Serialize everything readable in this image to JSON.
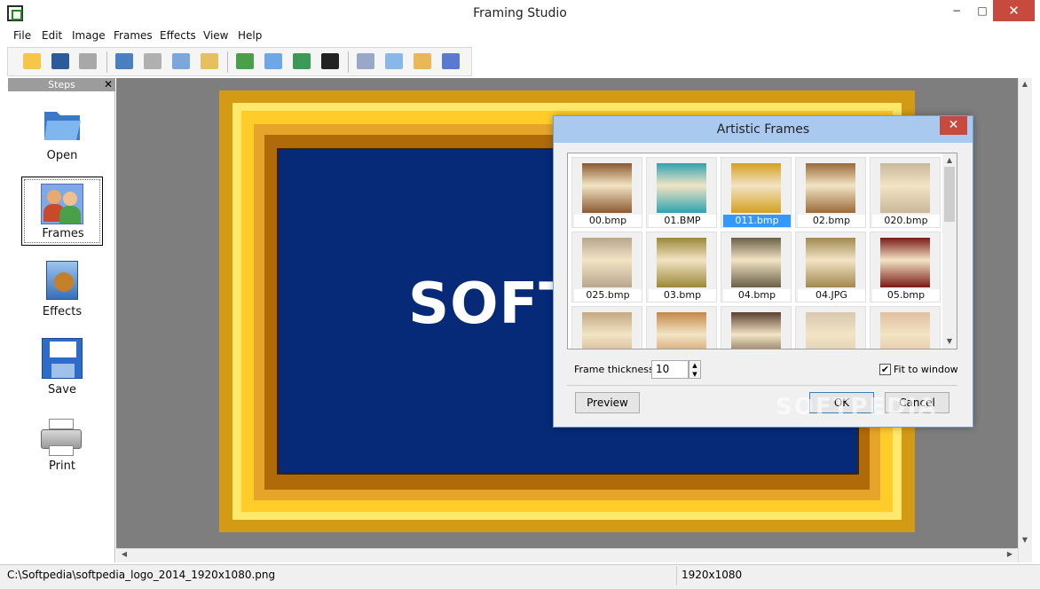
{
  "window": {
    "title": "Framing Studio",
    "minimize": "−",
    "maximize": "□",
    "close": "✕"
  },
  "menu": [
    "File",
    "Edit",
    "Image",
    "Frames",
    "Effects",
    "View",
    "Help"
  ],
  "toolbar": {
    "icons": [
      "open-folder-icon",
      "save-icon",
      "print-icon",
      "undo-icon",
      "redo-icon",
      "copy-icon",
      "paste-icon",
      "frames-icon",
      "effects-icon",
      "image-icon",
      "border-icon",
      "crop-icon",
      "zoom-icon",
      "text-icon",
      "page-icon"
    ]
  },
  "steps": {
    "header": "Steps",
    "close": "✕",
    "items": [
      {
        "label": "Open",
        "icon": "open-folder-icon"
      },
      {
        "label": "Frames",
        "icon": "frames-users-icon"
      },
      {
        "label": "Effects",
        "icon": "effects-icon"
      },
      {
        "label": "Save",
        "icon": "save-floppy-icon"
      },
      {
        "label": "Print",
        "icon": "printer-icon"
      }
    ]
  },
  "canvas": {
    "logo_text": "SOFT"
  },
  "dialog": {
    "title": "Artistic Frames",
    "close": "✕",
    "frames": [
      {
        "label": "00.bmp",
        "color": "#8a5a32",
        "selected": false
      },
      {
        "label": "01.BMP",
        "color": "#2ea3b0",
        "selected": false
      },
      {
        "label": "011.bmp",
        "color": "#d4a020",
        "selected": true
      },
      {
        "label": "02.bmp",
        "color": "#9a6a3a",
        "selected": false
      },
      {
        "label": "020.bmp",
        "color": "#c9b79a",
        "selected": false
      },
      {
        "label": "025.bmp",
        "color": "#b9a58e",
        "selected": false
      },
      {
        "label": "03.bmp",
        "color": "#9a8838",
        "selected": false
      },
      {
        "label": "04.bmp",
        "color": "#6a6048",
        "selected": false
      },
      {
        "label": "04.JPG",
        "color": "#a08850",
        "selected": false
      },
      {
        "label": "05.bmp",
        "color": "#7a1a18",
        "selected": false
      },
      {
        "label": "",
        "color": "#c4a884",
        "selected": false
      },
      {
        "label": "",
        "color": "#c48848",
        "selected": false
      },
      {
        "label": "",
        "color": "#5a4030",
        "selected": false
      },
      {
        "label": "",
        "color": "#d8c8b0",
        "selected": false
      },
      {
        "label": "",
        "color": "#e0c0a0",
        "selected": false
      }
    ],
    "frame_thickness_label": "Frame thickness",
    "frame_thickness_value": "10",
    "fit_to_window_label": "Fit to window",
    "fit_to_window_checked": true,
    "preview_button": "Preview",
    "ok_button": "OK",
    "cancel_button": "Cancel"
  },
  "watermark": "SOFTPEDIA",
  "status": {
    "path": "C:\\Softpedia\\softpedia_logo_2014_1920x1080.png",
    "size": "1920x1080"
  }
}
